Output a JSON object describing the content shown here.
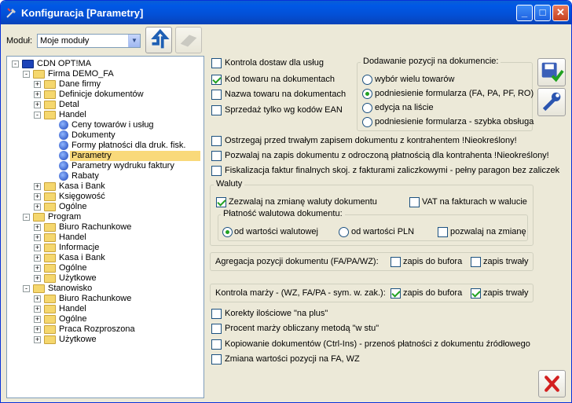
{
  "window": {
    "title": "Konfiguracja [Parametry]"
  },
  "module": {
    "label": "Moduł:",
    "value": "Moje moduły"
  },
  "tree": [
    {
      "label": "CDN OPT!MA",
      "level": 0,
      "kind": "root",
      "exp": "-"
    },
    {
      "label": "Firma DEMO_FA",
      "level": 1,
      "kind": "folder",
      "exp": "-"
    },
    {
      "label": "Dane firmy",
      "level": 2,
      "kind": "folder",
      "exp": "+"
    },
    {
      "label": "Definicje dokumentów",
      "level": 2,
      "kind": "folder",
      "exp": "+"
    },
    {
      "label": "Detal",
      "level": 2,
      "kind": "folder",
      "exp": "+"
    },
    {
      "label": "Handel",
      "level": 2,
      "kind": "folder",
      "exp": "-"
    },
    {
      "label": "Ceny towarów i usług",
      "level": 3,
      "kind": "doc"
    },
    {
      "label": "Dokumenty",
      "level": 3,
      "kind": "doc"
    },
    {
      "label": "Formy płatności dla druk. fisk.",
      "level": 3,
      "kind": "doc"
    },
    {
      "label": "Parametry",
      "level": 3,
      "kind": "doc",
      "selected": true
    },
    {
      "label": "Parametry wydruku faktury",
      "level": 3,
      "kind": "doc"
    },
    {
      "label": "Rabaty",
      "level": 3,
      "kind": "doc"
    },
    {
      "label": "Kasa i Bank",
      "level": 2,
      "kind": "folder",
      "exp": "+"
    },
    {
      "label": "Księgowość",
      "level": 2,
      "kind": "folder",
      "exp": "+"
    },
    {
      "label": "Ogólne",
      "level": 2,
      "kind": "folder",
      "exp": "+"
    },
    {
      "label": "Program",
      "level": 1,
      "kind": "folder",
      "exp": "-"
    },
    {
      "label": "Biuro Rachunkowe",
      "level": 2,
      "kind": "folder",
      "exp": "+"
    },
    {
      "label": "Handel",
      "level": 2,
      "kind": "folder",
      "exp": "+"
    },
    {
      "label": "Informacje",
      "level": 2,
      "kind": "folder",
      "exp": "+"
    },
    {
      "label": "Kasa i Bank",
      "level": 2,
      "kind": "folder",
      "exp": "+"
    },
    {
      "label": "Ogólne",
      "level": 2,
      "kind": "folder",
      "exp": "+"
    },
    {
      "label": "Użytkowe",
      "level": 2,
      "kind": "folder",
      "exp": "+"
    },
    {
      "label": "Stanowisko",
      "level": 1,
      "kind": "folder",
      "exp": "-"
    },
    {
      "label": "Biuro Rachunkowe",
      "level": 2,
      "kind": "folder",
      "exp": "+"
    },
    {
      "label": "Handel",
      "level": 2,
      "kind": "folder",
      "exp": "+"
    },
    {
      "label": "Ogólne",
      "level": 2,
      "kind": "folder",
      "exp": "+"
    },
    {
      "label": "Praca Rozproszona",
      "level": 2,
      "kind": "folder",
      "exp": "+"
    },
    {
      "label": "Użytkowe",
      "level": 2,
      "kind": "folder",
      "exp": "+"
    }
  ],
  "opts": {
    "kontrola_dostaw": {
      "label": "Kontrola dostaw dla usług",
      "checked": false
    },
    "kod_towaru": {
      "label": "Kod towaru na dokumentach",
      "checked": true
    },
    "nazwa_towaru": {
      "label": "Nazwa towaru na dokumentach",
      "checked": false
    },
    "sprzedaz_ean": {
      "label": "Sprzedaż tylko wg kodów EAN",
      "checked": false
    },
    "ostrzegaj": {
      "label": "Ostrzegaj przed trwałym zapisem dokumentu z kontrahentem !Nieokreślony!",
      "checked": false
    },
    "pozwalaj": {
      "label": "Pozwalaj na zapis dokumentu z odroczoną płatnością dla kontrahenta !Nieokreślony!",
      "checked": false
    },
    "fiskalizacja": {
      "label": "Fiskalizacja faktur finalnych skoj. z fakturami zaliczkowymi - pełny paragon bez zaliczek",
      "checked": false
    },
    "korekty": {
      "label": "Korekty ilościowe \"na plus\"",
      "checked": false
    },
    "procent": {
      "label": "Procent marży obliczany metodą \"w stu\"",
      "checked": false
    },
    "kopiowanie": {
      "label": "Kopiowanie dokumentów (Ctrl-Ins) - przenoś płatności z dokumentu źródłowego",
      "checked": false
    },
    "zmiana": {
      "label": "Zmiana wartości pozycji na FA, WZ",
      "checked": false
    }
  },
  "dodawanie": {
    "title": "Dodawanie pozycji na dokumencie:",
    "options": [
      "wybór wielu towarów",
      "podniesienie formularza (FA, PA, PF, RO)",
      "edycja na liście",
      "podniesienie formularza - szybka obsługa"
    ],
    "selected": 1
  },
  "waluty": {
    "title": "Waluty",
    "zezwalaj": {
      "label": "Zezwalaj na zmianę waluty dokumentu",
      "checked": true
    },
    "vat": {
      "label": "VAT na fakturach w walucie",
      "checked": false
    },
    "platnosc_title": "Płatność walutowa dokumentu:",
    "r1": "od wartości walutowej",
    "r2": "od wartości PLN",
    "selected": 0,
    "pozwalaj": {
      "label": "pozwalaj na zmianę",
      "checked": false
    }
  },
  "agregacja": {
    "label": "Agregacja pozycji dokumentu (FA/PA/WZ):",
    "bufor": {
      "label": "zapis do bufora",
      "checked": false
    },
    "trwaly": {
      "label": "zapis trwały",
      "checked": false
    }
  },
  "marza": {
    "label": "Kontrola marży - (WZ, FA/PA - sym. w. zak.):",
    "bufor": {
      "label": "zapis do bufora",
      "checked": true
    },
    "trwaly": {
      "label": "zapis trwały",
      "checked": true
    }
  },
  "colors": {
    "title_bar": "#0058e6",
    "selection": "#f9d97a",
    "check": "#21a121"
  }
}
